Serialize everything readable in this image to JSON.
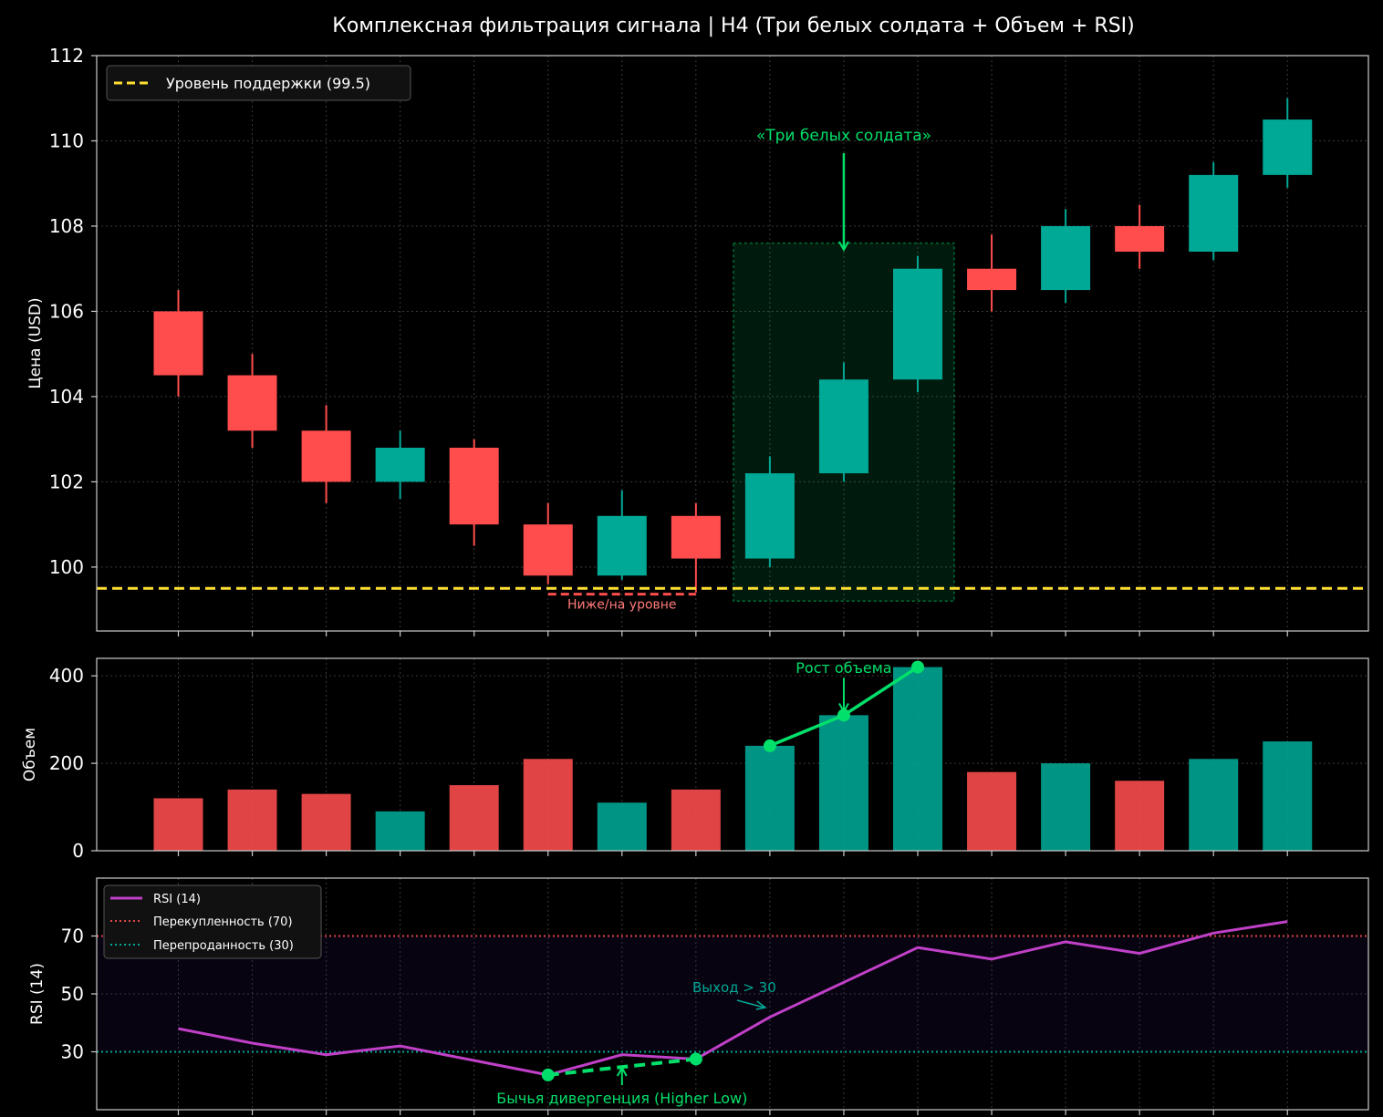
{
  "chart_data": {
    "title": "Комплексная фильтрация сигнала | H4 (Три белых солдата + Объем + RSI)",
    "colors": {
      "bull": "#00a896",
      "bear": "#ff4d4d",
      "support": "#ffe033",
      "accent": "#00e06a",
      "rsi": "#c040c8",
      "overbought": "#e04545",
      "oversold": "#00a896",
      "grid": "#3a3a3a",
      "frame": "#cccccc"
    },
    "price": {
      "type": "candlestick",
      "ylabel": "Цена (USD)",
      "ylim": [
        98.5,
        112
      ],
      "yticks": [
        100,
        102,
        104,
        106,
        108,
        110,
        112
      ],
      "grid": true,
      "legend_position": "top-left",
      "support": {
        "value": 99.5,
        "label": "Уровень поддержки (99.5)"
      },
      "candles": [
        {
          "o": 106.0,
          "h": 106.5,
          "l": 104.0,
          "c": 104.5
        },
        {
          "o": 104.5,
          "h": 105.0,
          "l": 102.8,
          "c": 103.2
        },
        {
          "o": 103.2,
          "h": 103.8,
          "l": 101.5,
          "c": 102.0
        },
        {
          "o": 102.0,
          "h": 103.2,
          "l": 101.6,
          "c": 102.8
        },
        {
          "o": 102.8,
          "h": 103.0,
          "l": 100.5,
          "c": 101.0
        },
        {
          "o": 101.0,
          "h": 101.5,
          "l": 99.6,
          "c": 99.8
        },
        {
          "o": 99.8,
          "h": 101.8,
          "l": 99.7,
          "c": 101.2
        },
        {
          "o": 101.2,
          "h": 101.5,
          "l": 99.4,
          "c": 100.2
        },
        {
          "o": 100.2,
          "h": 102.6,
          "l": 100.0,
          "c": 102.2
        },
        {
          "o": 102.2,
          "h": 104.8,
          "l": 102.0,
          "c": 104.4
        },
        {
          "o": 104.4,
          "h": 107.3,
          "l": 104.1,
          "c": 107.0
        },
        {
          "o": 107.0,
          "h": 107.8,
          "l": 106.0,
          "c": 106.5
        },
        {
          "o": 106.5,
          "h": 108.4,
          "l": 106.2,
          "c": 108.0
        },
        {
          "o": 108.0,
          "h": 108.5,
          "l": 107.0,
          "c": 107.4
        },
        {
          "o": 107.4,
          "h": 109.5,
          "l": 107.2,
          "c": 109.2
        },
        {
          "o": 109.2,
          "h": 111.0,
          "l": 108.9,
          "c": 110.5
        }
      ],
      "pattern_box": {
        "from_index": 8,
        "to_index": 10,
        "ymin": 99.2,
        "ymax": 107.6
      },
      "pattern_label": "«Три белых солдата»",
      "pattern_arrow": {
        "index": 9,
        "y_from": 107.8,
        "y_to": 107.4
      },
      "below_level_label": "Ниже/на уровне",
      "below_level_segment": {
        "from_index": 5,
        "to_index": 7,
        "y": 99.45
      }
    },
    "volume": {
      "type": "bar",
      "ylabel": "Объем",
      "ylim": [
        0,
        440
      ],
      "yticks": [
        0,
        200,
        400
      ],
      "grid": true,
      "values": [
        120,
        140,
        130,
        90,
        150,
        210,
        110,
        140,
        240,
        310,
        420,
        180,
        200,
        160,
        210,
        250
      ],
      "growth_indices": [
        8,
        9,
        10
      ],
      "growth_label": "Рост объема",
      "growth_arrow": {
        "index": 9,
        "y_from": 395,
        "y_to": 318
      }
    },
    "rsi": {
      "type": "line",
      "ylabel": "RSI (14)",
      "ylim": [
        10,
        90
      ],
      "yticks": [
        30,
        50,
        70
      ],
      "grid": true,
      "legend_position": "top-left",
      "values": [
        38,
        33,
        29,
        32,
        27,
        22,
        29,
        27.5,
        42,
        54,
        66,
        62,
        68,
        64,
        71,
        75
      ],
      "series_name": "RSI (14)",
      "overbought": {
        "value": 70,
        "label": "Перекупленность (70)"
      },
      "oversold": {
        "value": 30,
        "label": "Перепроданность (30)"
      },
      "divergence": {
        "from_index": 5,
        "to_index": 7,
        "label": "Бычья дивергенция (Higher Low)"
      },
      "exit_label": "Выход > 30"
    }
  }
}
